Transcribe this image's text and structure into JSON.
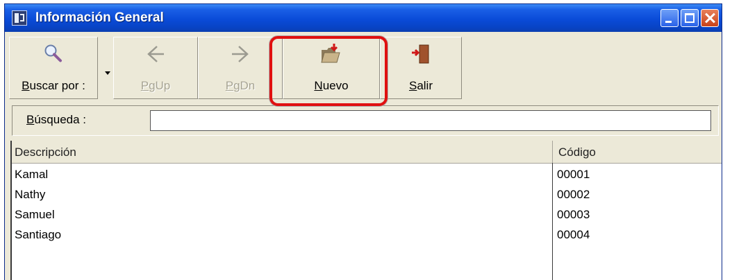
{
  "window": {
    "title": "Información General"
  },
  "toolbar": {
    "buttons": [
      {
        "id": "buscar",
        "label_first": "B",
        "label_rest": "uscar por :",
        "icon": "magnifier-icon",
        "enabled": true
      },
      {
        "id": "pgup",
        "label_first": "P",
        "label_rest": "gUp",
        "icon": "arrow-left-icon",
        "enabled": false
      },
      {
        "id": "pgdn",
        "label_first": "P",
        "label_rest": "gDn",
        "icon": "arrow-right-icon",
        "enabled": false
      },
      {
        "id": "nuevo",
        "label_first": "N",
        "label_rest": "uevo",
        "icon": "new-folder-icon",
        "enabled": true
      },
      {
        "id": "salir",
        "label_first": "S",
        "label_rest": "alir",
        "icon": "exit-door-icon",
        "enabled": true
      }
    ],
    "highlighted": "nuevo",
    "highlight_color": "#E01010"
  },
  "search": {
    "label_first": "B",
    "label_rest": "úsqueda :",
    "value": ""
  },
  "grid": {
    "columns": [
      "Descripción",
      "Código"
    ],
    "rows": [
      {
        "descripcion": "Kamal",
        "codigo": "00001"
      },
      {
        "descripcion": "Nathy",
        "codigo": "00002"
      },
      {
        "descripcion": "Samuel",
        "codigo": "00003"
      },
      {
        "descripcion": "Santiago",
        "codigo": "00004"
      }
    ]
  },
  "colors": {
    "titlebar": "#0A4BD8",
    "face": "#ECE9D8",
    "disabled_text": "#A7A493"
  }
}
